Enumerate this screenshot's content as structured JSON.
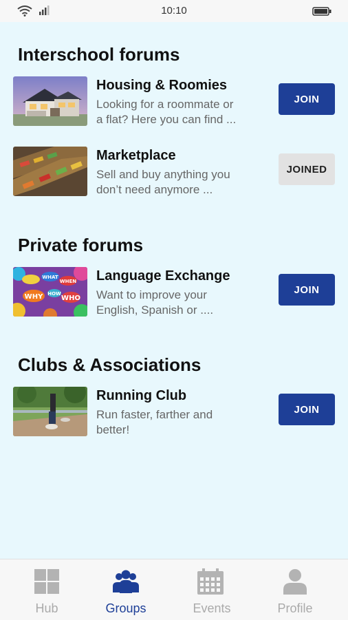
{
  "status_bar": {
    "time": "10:10"
  },
  "sections": {
    "interschool": {
      "title": "Interschool forums",
      "items": [
        {
          "title": "Housing & Roomies",
          "desc_line1": "Looking for a roommate or",
          "desc_line2": "a flat? Here you can find ...",
          "button": "JOIN",
          "state": "join"
        },
        {
          "title": "Marketplace",
          "desc_line1": "Sell and buy anything you",
          "desc_line2": "don’t need anymore ...",
          "button": "JOINED",
          "state": "joined"
        }
      ]
    },
    "private": {
      "title": "Private forums",
      "items": [
        {
          "title": "Language Exchange",
          "desc_line1": "Want to improve your",
          "desc_line2": "English, Spanish or ....",
          "button": "JOIN",
          "state": "join"
        }
      ]
    },
    "clubs": {
      "title": "Clubs & Associations",
      "items": [
        {
          "title": "Running Club",
          "desc_line1": "Run faster, farther and",
          "desc_line2": "better!",
          "button": "JOIN",
          "state": "join"
        }
      ]
    }
  },
  "tabs": [
    {
      "label": "Hub",
      "icon": "grid-icon",
      "active": false
    },
    {
      "label": "Groups",
      "icon": "group-icon",
      "active": true
    },
    {
      "label": "Events",
      "icon": "calendar-icon",
      "active": false
    },
    {
      "label": "Profile",
      "icon": "person-icon",
      "active": false
    }
  ],
  "thumb_bubbles": [
    "WHY",
    "WHAT",
    "WHEN",
    "HOW",
    "WHO"
  ],
  "colors": {
    "accent": "#1e3f97",
    "background": "#e8f8fd",
    "inactive_tab": "#aaaaaa"
  }
}
